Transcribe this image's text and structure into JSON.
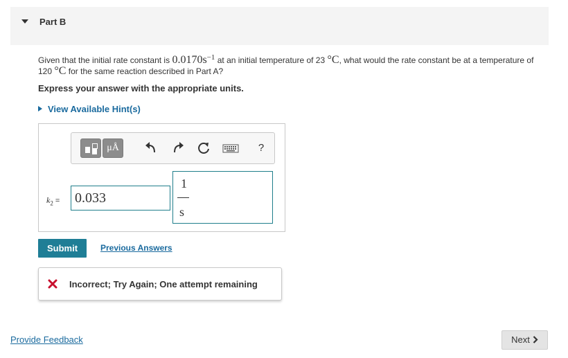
{
  "part": {
    "title": "Part B"
  },
  "question": {
    "text1": "Given that the initial rate constant is ",
    "rate_value": "0.0170s",
    "rate_exp": "−1",
    "text2": " at an initial temperature of 23 ",
    "temp_unit1": "°C",
    "text3": ", what would the rate constant be at a temperature of 120 ",
    "temp_unit2": "°C",
    "text4": " for the same reaction described in Part A?"
  },
  "instruction": "Express your answer with the appropriate units.",
  "hint": {
    "label": "View Available Hint(s)"
  },
  "toolbar": {
    "units_label": "μÅ",
    "icons": [
      "templates-icon",
      "units-icon",
      "undo-icon",
      "redo-icon",
      "reset-icon",
      "keyboard-icon",
      "help-icon"
    ],
    "help_label": "?"
  },
  "answer": {
    "variable": "k",
    "subscript": "2",
    "equals": "=",
    "value": "0.033",
    "units": {
      "numerator": "1",
      "denominator": "s"
    }
  },
  "actions": {
    "submit_label": "Submit",
    "previous_answers_label": "Previous Answers"
  },
  "feedback": {
    "message": "Incorrect; Try Again; One attempt remaining",
    "status_color": "#c8102e"
  },
  "footer": {
    "provide_feedback_label": "Provide Feedback",
    "next_label": "Next"
  },
  "colors": {
    "accent": "#1f7e96",
    "link": "#1a6a9e"
  }
}
